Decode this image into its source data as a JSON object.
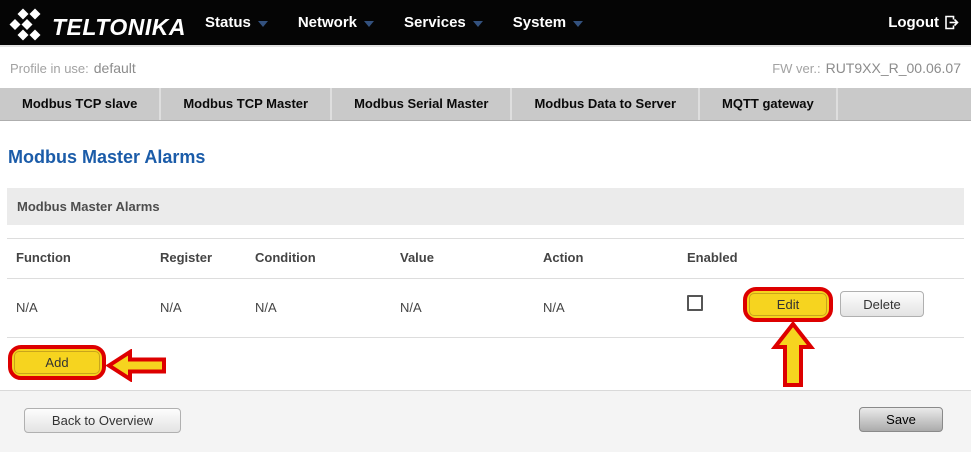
{
  "navbar": {
    "brand": "TELTONIKA",
    "items": [
      {
        "label": "Status"
      },
      {
        "label": "Network"
      },
      {
        "label": "Services"
      },
      {
        "label": "System"
      }
    ],
    "logout_label": "Logout"
  },
  "statusbar": {
    "profile_label": "Profile in use:",
    "profile_value": "default",
    "fw_label": "FW ver.:",
    "fw_value": "RUT9XX_R_00.06.07"
  },
  "tabs": [
    {
      "label": "Modbus TCP slave"
    },
    {
      "label": "Modbus TCP Master"
    },
    {
      "label": "Modbus Serial Master"
    },
    {
      "label": "Modbus Data to Server"
    },
    {
      "label": "MQTT gateway"
    }
  ],
  "page": {
    "title": "Modbus Master Alarms",
    "section_title": "Modbus Master Alarms"
  },
  "table": {
    "columns": [
      "Function",
      "Register",
      "Condition",
      "Value",
      "Action",
      "Enabled"
    ],
    "rows": [
      {
        "function": "N/A",
        "register": "N/A",
        "condition": "N/A",
        "value": "N/A",
        "action": "N/A",
        "enabled": false,
        "edit_label": "Edit",
        "delete_label": "Delete"
      }
    ],
    "add_label": "Add"
  },
  "footer": {
    "back_label": "Back to Overview",
    "save_label": "Save"
  },
  "icons": {
    "brand_logo": "teltonika-diamonds-logo",
    "nav_caret": "chevron-down-icon",
    "logout": "exit-door-icon"
  },
  "colors": {
    "navbar_bg": "#050505",
    "tabbar_bg": "#c9c9c9",
    "title_blue": "#1b5ca9",
    "highlight_yellow": "#f6d41f",
    "highlight_red": "#dd0000",
    "footer_bg": "#f4f4f4"
  },
  "annotations": {
    "highlighted_buttons": [
      "Edit",
      "Add"
    ],
    "arrow_color_fill": "#f6d41f",
    "arrow_color_stroke": "#dd0000"
  }
}
